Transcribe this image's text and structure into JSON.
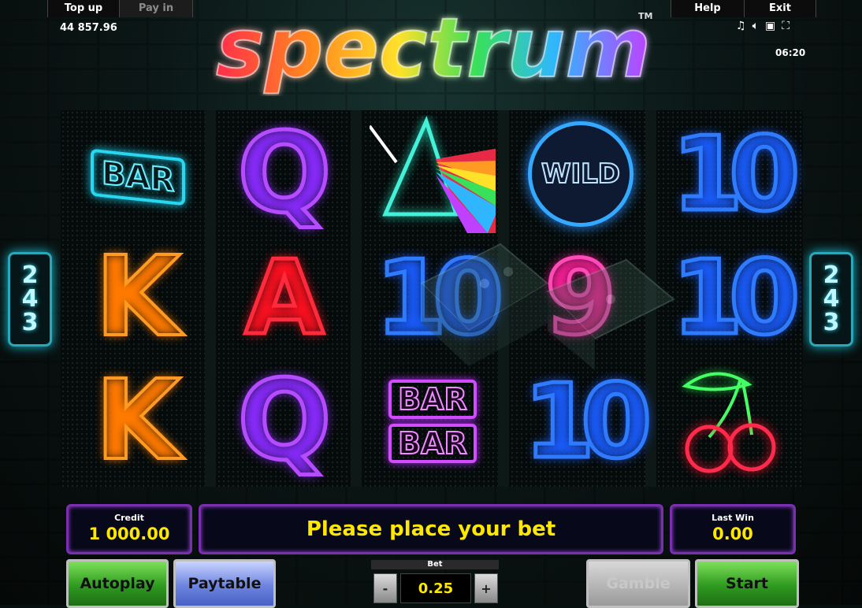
{
  "top_bar": {
    "top_up": "Top up",
    "pay_in": "Pay in",
    "help": "Help",
    "exit": "Exit",
    "balance": "44 857.96",
    "time": "06:20",
    "icons": [
      "music-icon",
      "sound-icon",
      "window-icon",
      "fullscreen-icon"
    ]
  },
  "logo": {
    "text": "spectrum",
    "trademark": "TM"
  },
  "ways": {
    "left": [
      "2",
      "4",
      "3"
    ],
    "right": [
      "2",
      "4",
      "3"
    ]
  },
  "reels": [
    [
      "BAR",
      "K",
      "K"
    ],
    [
      "Q",
      "A",
      "Q"
    ],
    [
      "prism",
      "10",
      "BAR BAR"
    ],
    [
      "WILD",
      "9",
      "10"
    ],
    [
      "10",
      "10",
      "cherries"
    ]
  ],
  "symbol_labels": {
    "bar": "BAR",
    "wild": "WILD",
    "k": "K",
    "q": "Q",
    "a": "A",
    "ten": "10",
    "nine": "9"
  },
  "credit": {
    "label": "Credit",
    "value": "1 000.00"
  },
  "message": "Please place your bet",
  "last_win": {
    "label": "Last Win",
    "value": "0.00"
  },
  "bet": {
    "label": "Bet",
    "value": "0.25",
    "minus": "-",
    "plus": "+"
  },
  "buttons": {
    "autoplay": "Autoplay",
    "paytable": "Paytable",
    "gamble": "Gamble",
    "start": "Start"
  },
  "colors": {
    "accent": "#ffe800",
    "panel_border": "#7a2fb0",
    "ways_border": "#2aa7b8"
  }
}
